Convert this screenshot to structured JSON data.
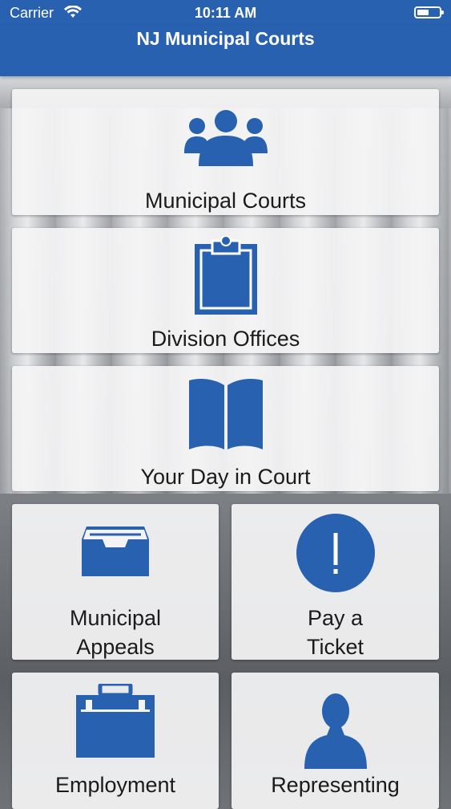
{
  "status_bar": {
    "carrier": "Carrier",
    "time": "10:11 AM"
  },
  "header": {
    "title": "NJ Municipal Courts"
  },
  "tiles": [
    {
      "label": "Municipal Courts",
      "icon": "people-group-icon"
    },
    {
      "label": "Division Offices",
      "icon": "clipboard-icon"
    },
    {
      "label": "Your Day in Court",
      "icon": "open-book-icon"
    },
    {
      "label_line1": "Municipal",
      "label_line2": "Appeals",
      "icon": "inbox-tray-icon"
    },
    {
      "label_line1": "Pay a",
      "label_line2": "Ticket",
      "icon": "exclamation-circle-icon"
    },
    {
      "label": "Employment",
      "icon": "briefcase-icon"
    },
    {
      "label": "Representing",
      "icon": "person-silhouette-icon"
    }
  ],
  "colors": {
    "brand": "#2761b0",
    "icon": "#2761b0"
  }
}
